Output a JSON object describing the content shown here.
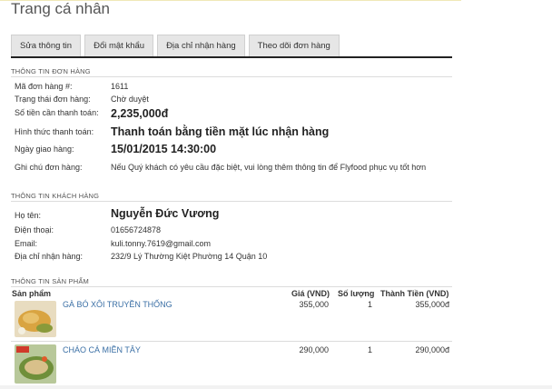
{
  "page": {
    "title": "Trang cá nhân"
  },
  "tabs": [
    {
      "label": "Sửa thông tin"
    },
    {
      "label": "Đổi mật khẩu"
    },
    {
      "label": "Địa chỉ nhận hàng"
    },
    {
      "label": "Theo dõi đơn hàng"
    }
  ],
  "order": {
    "section_title": "THÔNG TIN ĐƠN HÀNG",
    "fields": {
      "id": {
        "label": "Mã đơn hàng #:",
        "value": "1611"
      },
      "status": {
        "label": "Trạng thái đơn hàng:",
        "value": "Chờ duyệt"
      },
      "amount": {
        "label": "Số tiền cần thanh toán:",
        "value": "2,235,000đ"
      },
      "payment": {
        "label": "Hình thức thanh toán:",
        "value": "Thanh toán bằng tiền mặt lúc nhận hàng"
      },
      "delivery_date": {
        "label": "Ngày giao hàng:",
        "value": "15/01/2015 14:30:00"
      },
      "note": {
        "label": "Ghi chú đơn hàng:",
        "value": "Nếu Quý khách có yêu cầu đặc biệt, vui lòng thêm thông tin để Flyfood phục vụ tốt hơn"
      }
    }
  },
  "customer": {
    "section_title": "THÔNG TIN KHÁCH HÀNG",
    "fields": {
      "name": {
        "label": "Họ tên:",
        "value": "Nguyễn Đức Vương"
      },
      "phone": {
        "label": "Điện thoại:",
        "value": "01656724878"
      },
      "email": {
        "label": "Email:",
        "value": "kuli.tonny.7619@gmail.com"
      },
      "address": {
        "label": "Địa chỉ nhận hàng:",
        "value": "232/9 Lý Thường Kiệt Phường 14 Quận 10"
      }
    }
  },
  "products": {
    "section_title": "THÔNG TIN SẢN PHẨM",
    "headers": {
      "product": "Sản phẩm",
      "price": "Giá (VND)",
      "qty": "Số lượng",
      "total": "Thành Tiền (VND)"
    },
    "items": [
      {
        "name": "GÀ BÓ XÔI TRUYỀN THỐNG",
        "price": "355,000",
        "qty": "1",
        "total": "355,000đ"
      },
      {
        "name": "CHÁO CÁ MIỀN TÂY",
        "price": "290,000",
        "qty": "1",
        "total": "290,000đ"
      }
    ]
  }
}
